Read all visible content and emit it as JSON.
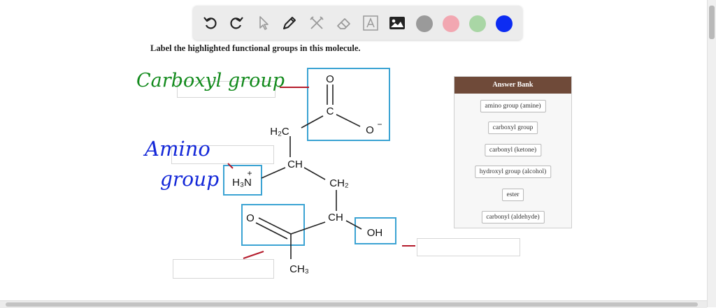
{
  "toolbar": {
    "tools": [
      {
        "name": "undo-icon"
      },
      {
        "name": "redo-icon"
      },
      {
        "name": "pointer-icon"
      },
      {
        "name": "pen-icon"
      },
      {
        "name": "tools-icon"
      },
      {
        "name": "eraser-icon"
      },
      {
        "name": "text-icon"
      },
      {
        "name": "image-icon"
      }
    ],
    "colors": [
      "#9a9a9a",
      "#f2a7b1",
      "#a9d6a5",
      "#0d2cf2"
    ]
  },
  "question": {
    "instructions": "Label the highlighted functional groups in this molecule."
  },
  "answer_bank": {
    "title": "Answer Bank",
    "items": [
      "amino group (amine)",
      "carboxyl group",
      "carbonyl (ketone)",
      "hydroxyl group (alcohol)",
      "ester",
      "carbonyl (aldehyde)"
    ]
  },
  "molecule": {
    "atoms": {
      "o_top": "O",
      "c_carboxyl": "C",
      "o_minus": "O",
      "o_charge": "−",
      "h2c": "H₂C",
      "ch_1": "CH",
      "h3n": "H₃N",
      "n_charge": "+",
      "ch2": "CH₂",
      "ch_2": "CH",
      "o_ketone": "O",
      "oh": "OH",
      "ch3": "CH₃"
    }
  },
  "annotations": {
    "carboxyl": "Carboxyl group",
    "amino_line1": "Amino",
    "amino_line2": "group"
  },
  "colors": {
    "highlight": "#3ba3d3",
    "annotation_green": "#128a1c",
    "annotation_blue": "#1428d8",
    "pointer_line": "#b41b2b"
  }
}
